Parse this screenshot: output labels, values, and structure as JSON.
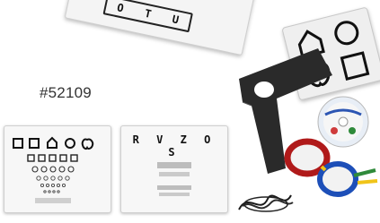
{
  "product_code": "#52109",
  "letter_strip": {
    "letters": [
      "O",
      "T",
      "U"
    ]
  },
  "right_chart": {
    "letters": [
      "R",
      "V",
      "Z",
      "O",
      "S"
    ]
  },
  "cd": {
    "label": ""
  },
  "colors": {
    "occluder": "#2a2a2a",
    "glasses_red": "#b01a1a",
    "glasses_blue": "#1d4fb8",
    "glasses_yellow": "#f0c419",
    "glasses_green": "#2f8a3a"
  },
  "icons": {
    "symbol_card": [
      "house-icon",
      "circle-icon",
      "apple-icon",
      "square-icon"
    ],
    "left_chart_top_row": [
      "square-icon",
      "square-icon",
      "house-icon",
      "circle-icon",
      "apple-icon"
    ]
  }
}
